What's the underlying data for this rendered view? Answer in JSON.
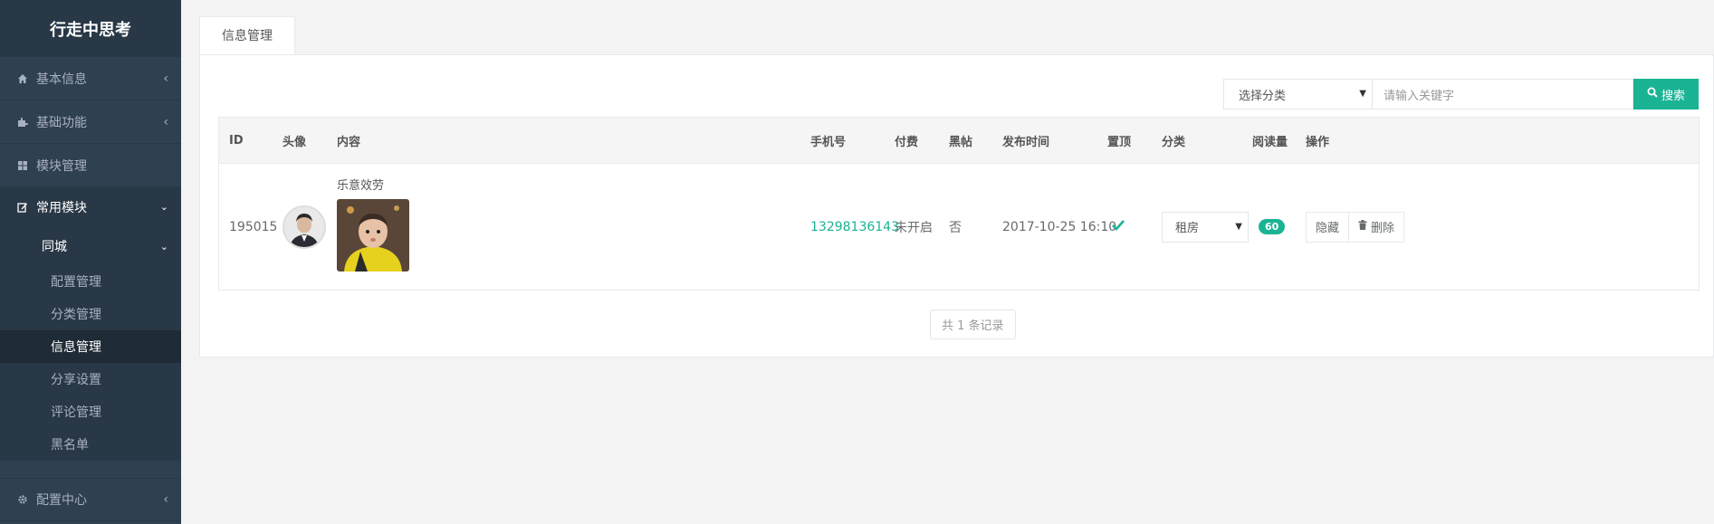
{
  "sidebar": {
    "brand": "行走中思考",
    "items": [
      {
        "label": "基本信息",
        "icon": "home-icon"
      },
      {
        "label": "基础功能",
        "icon": "puzzle-icon"
      },
      {
        "label": "模块管理",
        "icon": "grid-icon"
      },
      {
        "label": "常用模块",
        "icon": "edit-icon"
      }
    ],
    "group": "同城",
    "subitems": [
      "配置管理",
      "分类管理",
      "信息管理",
      "分享设置",
      "评论管理",
      "黑名单"
    ],
    "bottom": {
      "label": "配置中心",
      "icon": "gear-icon"
    }
  },
  "tabs": [
    "信息管理"
  ],
  "toolbar": {
    "category_select": "选择分类",
    "search_placeholder": "请输入关键字",
    "search_button": "搜索"
  },
  "table": {
    "headers": [
      "ID",
      "头像",
      "内容",
      "手机号",
      "付费",
      "黑帖",
      "发布时间",
      "置顶",
      "分类",
      "阅读量",
      "操作"
    ],
    "rows": [
      {
        "id": "195015",
        "content_title": "乐意效劳",
        "phone": "13298136143",
        "paid": "未开启",
        "black": "否",
        "time": "2017-10-25 16:10",
        "category": "租房",
        "views": "60",
        "hide_btn": "隐藏",
        "delete_btn": "删除"
      }
    ]
  },
  "pager": "共 1 条记录",
  "colors": {
    "sidebar": "#2f4050",
    "accent": "#1ab394"
  }
}
